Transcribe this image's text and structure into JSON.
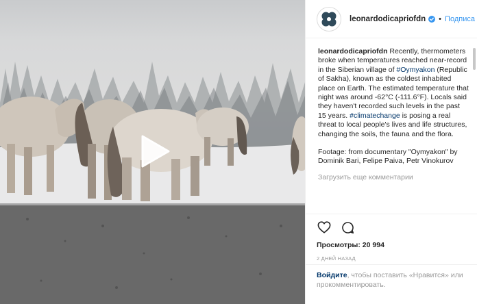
{
  "post": {
    "username": "leonardodicapriofdn",
    "separator": "•",
    "follow_label": "Подписа",
    "caption": {
      "username": "leonardodicapriofdn",
      "part1": " Recently, thermometers broke when temperatures reached near-record in the Siberian village of ",
      "tag1": "#Oymyakon",
      "part2": " (Republic of Sakha), known as the coldest inhabited place on Earth. The estimated temperature that night was around -62°C (-111.6°F). Locals said they haven't recorded such levels in the past 15 years. ",
      "tag2": "#climatechange",
      "part3": " is posing a real threat to local people's lives and life structures, changing the soils, the fauna and the flora.",
      "footage": "Footage: from documentary \"Oymyakon\" by Dominik Bari, Felipe Paiva, Petr Vinokurov"
    },
    "load_more": "Загрузить еще комментарии",
    "views": "Просмотры: 20 994",
    "timestamp": "2 ДНЕЙ НАЗАД",
    "login": {
      "link": "Войдите",
      "rest": ", чтобы поставить «Нравится» или прокомментировать."
    }
  },
  "icons": {
    "avatar": "foundation-logo-icon",
    "verified": "verified-badge-icon",
    "like": "heart-icon",
    "comment": "comment-icon",
    "play": "play-icon"
  },
  "colors": {
    "link_blue": "#3897f0",
    "hashtag": "#003569",
    "muted": "#999999",
    "text": "#262626"
  }
}
